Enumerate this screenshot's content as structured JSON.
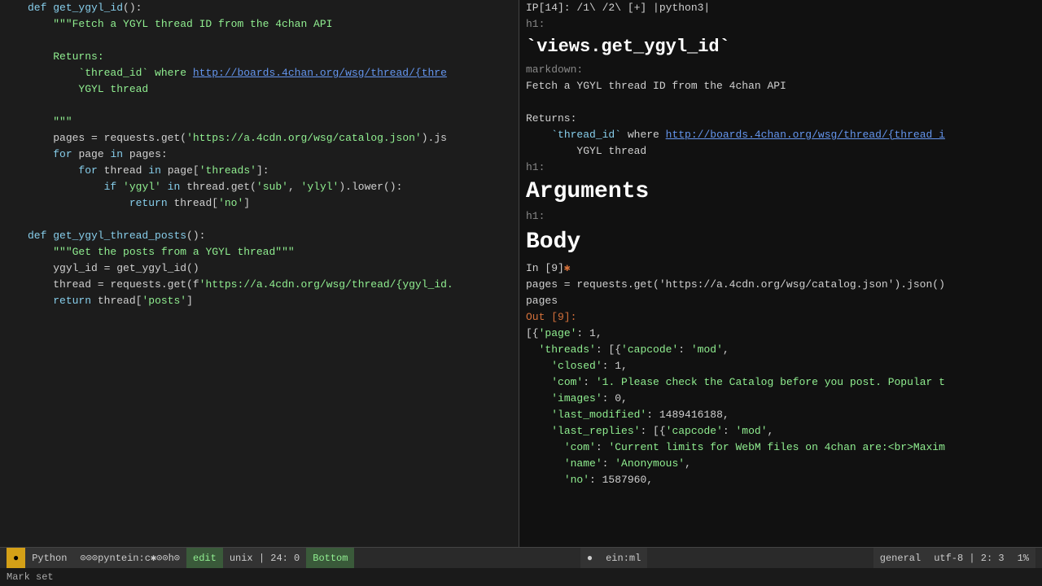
{
  "left": {
    "lines": [
      {
        "num": "",
        "content": "def_get_ygyl_id",
        "type": "def"
      },
      {
        "num": "",
        "content": "    \"\"\"Fetch a YGYL thread ID from the 4chan API",
        "type": "docstring"
      },
      {
        "num": "",
        "content": "",
        "type": "blank"
      },
      {
        "num": "",
        "content": "    Returns:",
        "type": "docstring"
      },
      {
        "num": "",
        "content": "        `thread_id` where http://boards.4chan.org/wsg/thread/{thre",
        "type": "docstring_url"
      },
      {
        "num": "",
        "content": "        YGYL thread",
        "type": "docstring"
      },
      {
        "num": "",
        "content": "",
        "type": "blank"
      },
      {
        "num": "",
        "content": "    \"\"\"",
        "type": "docstring"
      },
      {
        "num": "",
        "content": "    pages = requests.get('https://a.4cdn.org/wsg/catalog.json').js",
        "type": "code"
      },
      {
        "num": "",
        "content": "    for page in pages:",
        "type": "code"
      },
      {
        "num": "",
        "content": "        for thread in page['threads']:",
        "type": "code"
      },
      {
        "num": "",
        "content": "            if 'ygyl' in thread.get('sub', 'ylyl').lower():",
        "type": "code"
      },
      {
        "num": "",
        "content": "                return thread['no']",
        "type": "code"
      },
      {
        "num": "",
        "content": "",
        "type": "blank"
      },
      {
        "num": "",
        "content": "def get_ygyl_thread_posts():",
        "type": "def"
      },
      {
        "num": "",
        "content": "    \"\"\"Get the posts from a YGYL thread\"\"\"",
        "type": "docstring"
      },
      {
        "num": "",
        "content": "    ygyl_id = get_ygyl_id()",
        "type": "code"
      },
      {
        "num": "",
        "content": "    thread = requests.get(f'https://a.4cdn.org/wsg/thread/{ygyl_id.",
        "type": "code_thread"
      },
      {
        "num": "",
        "content": "    return thread['posts']",
        "type": "code"
      },
      {
        "num": "",
        "content": "",
        "type": "blank"
      },
      {
        "num": "",
        "content": "",
        "type": "blank"
      },
      {
        "num": "",
        "content": "",
        "type": "blank"
      },
      {
        "num": "",
        "content": "",
        "type": "blank"
      },
      {
        "num": "",
        "content": "",
        "type": "blank"
      },
      {
        "num": "",
        "content": "",
        "type": "blank"
      },
      {
        "num": "",
        "content": "",
        "type": "blank"
      },
      {
        "num": "",
        "content": "",
        "type": "blank"
      },
      {
        "num": "",
        "content": "",
        "type": "blank"
      },
      {
        "num": "",
        "content": "",
        "type": "blank"
      },
      {
        "num": "",
        "content": "",
        "type": "blank"
      },
      {
        "num": "",
        "content": "",
        "type": "blank"
      },
      {
        "num": "",
        "content": "",
        "type": "blank"
      },
      {
        "num": "",
        "content": "",
        "type": "blank"
      }
    ]
  },
  "right": {
    "prompt_line": "IP[14]: /1\\ /2\\ [+] |python3|",
    "h1_label_1": "h1:",
    "h1_text_1": "`views.get_ygyl_id`",
    "markdown_label": "markdown:",
    "markdown_text_1": "Fetch a YGYL thread ID from the 4chan API",
    "markdown_text_2": "",
    "markdown_text_3": "Returns:",
    "markdown_text_4_prefix": "    `thread_id` where ",
    "markdown_url": "http://boards.4chan.org/wsg/thread/{thread_i",
    "markdown_text_5": "        YGYL thread",
    "h1_label_2": "h1:",
    "h1_text_2": "Arguments",
    "h1_label_3": "h1:",
    "h1_text_3": "Body",
    "in_label": "In [9]",
    "in_star": "✱",
    "code_line_1": "pages = requests.get('https://a.4cdn.org/wsg/catalog.json').json()",
    "code_line_2": "pages",
    "out_label": "Out [9]:",
    "out_lines": [
      "[{'page': 1,",
      "  'threads': [{'capcode': 'mod',",
      "    'closed': 1,",
      "    'com': '1. Please check the Catalog before you post. Popular t",
      "    'images': 0,",
      "    'last_modified': 1489416188,",
      "    'last_replies': [{'capcode': 'mod',",
      "      'com': 'Current limits for WebM files on 4chan are:<br>Maxim",
      "      'name': 'Anonymous',",
      "      'no': 1587960,"
    ]
  },
  "status_bar": {
    "mode_label": "●",
    "python_label": "Python",
    "buffer_info": "⊙⊙⊙pyntein:c✱⊙⊙h⊙",
    "edit_label": "edit",
    "encoding": "unix | 24: 0",
    "bottom_label": "Bottom",
    "circle": "●",
    "ein_label": "ein:ml",
    "general_label": "general",
    "utf_label": "utf-8 | 2: 3",
    "percent_label": "1%"
  },
  "bottom_bar": {
    "text": "Mark set"
  }
}
